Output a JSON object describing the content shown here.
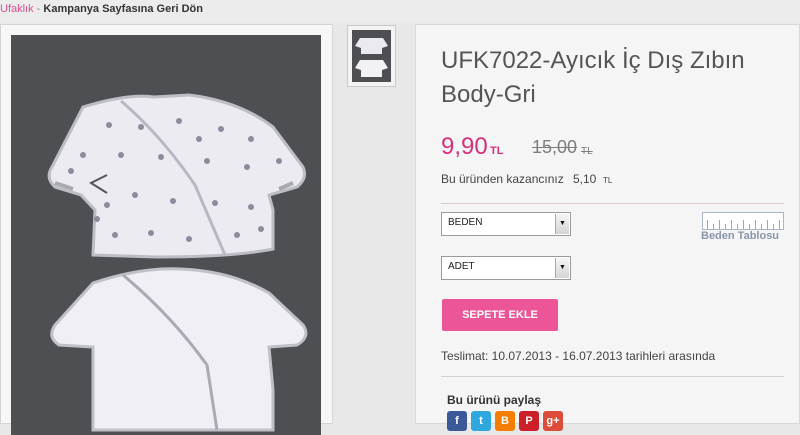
{
  "breadcrumb": {
    "brand": "Ufaklık",
    "separator": " - ",
    "back_label": "Kampanya Sayfasına Geri Dön"
  },
  "product": {
    "title": "UFK7022-Ayıcık İç Dış Zıbın Body-Gri",
    "price": "9,90",
    "price_currency": "TL",
    "old_price": "15,00",
    "old_currency": "TL",
    "savings_label": "Bu üründen kazancınız",
    "savings_value": "5,10",
    "savings_currency": "TL"
  },
  "options": {
    "size_select": "BEDEN",
    "qty_select": "ADET",
    "size_chart_label": "Beden Tablosu"
  },
  "actions": {
    "add_to_cart": "SEPETE EKLE"
  },
  "delivery": {
    "text": "Teslimat: 10.07.2013 - 16.07.2013 tarihleri arasında"
  },
  "share": {
    "label": "Bu ürünü paylaş",
    "icons": [
      "facebook-icon",
      "twitter-icon",
      "blogger-icon",
      "pinterest-icon",
      "google-plus-icon"
    ]
  },
  "colors": {
    "accent": "#ec5598",
    "price": "#d6317e",
    "photo_bg": "#4e4f53"
  }
}
